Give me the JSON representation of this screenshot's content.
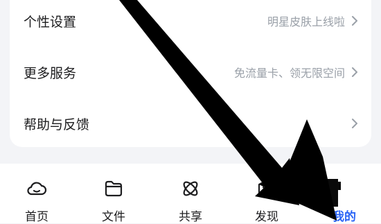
{
  "settings": {
    "rows": [
      {
        "label": "个性设置",
        "value": "明星皮肤上线啦"
      },
      {
        "label": "更多服务",
        "value": "免流量卡、领无限空间"
      },
      {
        "label": "帮助与反馈",
        "value": ""
      }
    ]
  },
  "tabbar": {
    "tabs": [
      {
        "label": "首页",
        "icon": "cloud-icon"
      },
      {
        "label": "文件",
        "icon": "folder-icon"
      },
      {
        "label": "共享",
        "icon": "atom-icon"
      },
      {
        "label": "发现",
        "icon": "discover-icon"
      },
      {
        "label": "我的",
        "icon": "profile-icon"
      }
    ],
    "active_index": 4
  },
  "colors": {
    "accent": "#2a64f6",
    "muted_text": "#9aa0a8",
    "background": "#f3f4f7",
    "annotation_arrow": "#000000"
  }
}
